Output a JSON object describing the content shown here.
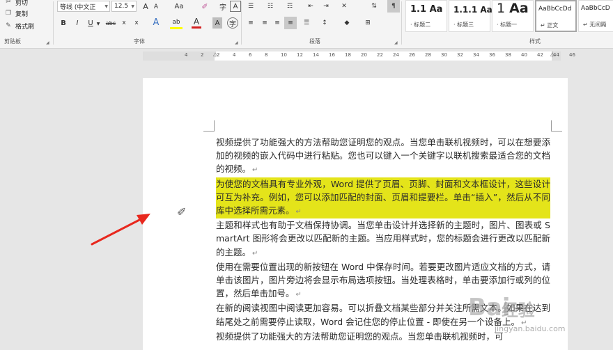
{
  "clipboard": {
    "cut_label": "剪切",
    "copy_label": "复制",
    "format_painter_label": "格式刷",
    "group_label": "剪贴板"
  },
  "font": {
    "font_name": "等线 (中文正",
    "font_size": "12.5",
    "group_label": "字体",
    "grow_label": "A",
    "shrink_label": "A",
    "case_label": "Aa",
    "bold_label": "B",
    "italic_label": "I",
    "underline_label": "U",
    "strike_label": "abc",
    "sub_label": "x",
    "sup_label": "x",
    "effects_label": "A",
    "highlight_label": "ab",
    "color_label": "A",
    "char_shade_label": "A",
    "enclose_label": "字"
  },
  "paragraph": {
    "group_label": "段落"
  },
  "styles": {
    "group_label": "样式",
    "items": [
      {
        "sample": "1.1",
        "sample2": "Aa",
        "name": "· 标题二"
      },
      {
        "sample": "1.1.1",
        "sample2": "Aa",
        "name": "· 标题三"
      },
      {
        "sample": "1",
        "sample2": "Aa",
        "name": "· 标题一"
      },
      {
        "sample": "AaBbCcDd",
        "sample2": "",
        "name": "↵ 正文"
      },
      {
        "sample": "AaBbCcD",
        "sample2": "",
        "name": "↵ 无间隔"
      }
    ]
  },
  "ruler": {
    "numbers": [
      "4",
      "2",
      "2",
      "4",
      "6",
      "8",
      "10",
      "12",
      "14",
      "16",
      "18",
      "20",
      "22",
      "24",
      "26",
      "28",
      "30",
      "32",
      "34",
      "36",
      "38",
      "40",
      "42",
      "44",
      "46"
    ]
  },
  "document": {
    "paragraphs": [
      {
        "text": "视频提供了功能强大的方法帮助您证明您的观点。当您单击联机视频时，可以在想要添加的视频的嵌入代码中进行粘贴。您也可以键入一个关键字以联机搜索最适合您的文档的视频。",
        "highlight": false
      },
      {
        "text": "为使您的文档具有专业外观，Word 提供了页眉、页脚、封面和文本框设计，这些设计可互为补充。例如，您可以添加匹配的封面、页眉和提要栏。单击“插入”，然后从不同库中选择所需元素。",
        "highlight": true
      },
      {
        "text": "主题和样式也有助于文档保持协调。当您单击设计并选择新的主题时，图片、图表或 SmartArt 图形将会更改以匹配新的主题。当应用样式时，您的标题会进行更改以匹配新的主题。",
        "highlight": false
      },
      {
        "text": "使用在需要位置出现的新按钮在 Word 中保存时间。若要更改图片适应文档的方式，请单击该图片，图片旁边将会显示布局选项按钮。当处理表格时，单击要添加行或列的位置，然后单击加号。",
        "highlight": false
      },
      {
        "text": "在新的阅读视图中阅读更加容易。可以折叠文档某些部分并关注所需文本。如果在达到结尾处之前需要停止读取，Word 会记住您的停止位置 - 即使在另一个设备上。",
        "highlight": false
      },
      {
        "text": "视频提供了功能强大的方法帮助您证明您的观点。当您单击联机视频时，可",
        "highlight": false
      }
    ],
    "para_mark": "↵"
  },
  "watermark": {
    "logo": "Bai",
    "text": "经验",
    "url": "jingyan.baidu.com"
  },
  "colors": {
    "highlight": "#e4e41a",
    "arrow": "#e8281e",
    "ribbon_bg": "#f4f4f4"
  }
}
